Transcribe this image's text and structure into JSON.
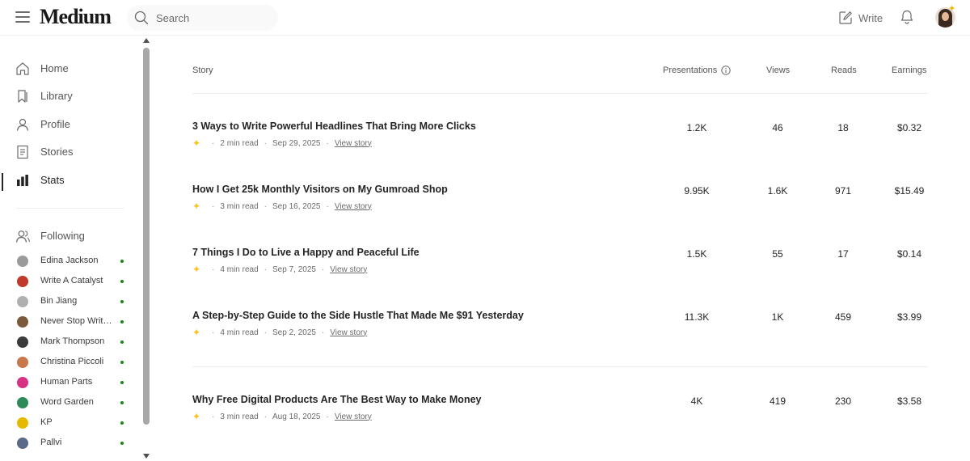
{
  "header": {
    "logo": "Medium",
    "search_placeholder": "Search",
    "write_label": "Write"
  },
  "sidebar": {
    "nav": [
      {
        "label": "Home",
        "icon": "home-icon"
      },
      {
        "label": "Library",
        "icon": "bookmark-icon"
      },
      {
        "label": "Profile",
        "icon": "person-icon"
      },
      {
        "label": "Stories",
        "icon": "document-icon"
      },
      {
        "label": "Stats",
        "icon": "bar-chart-icon",
        "active": true
      }
    ],
    "following_label": "Following",
    "following": [
      {
        "name": "Edina Jackson",
        "color": "#9a9a9a"
      },
      {
        "name": "Write A Catalyst",
        "color": "#c0392b"
      },
      {
        "name": "Bin Jiang",
        "color": "#b0b0b0"
      },
      {
        "name": "Never Stop Writing",
        "color": "#7a5a3a"
      },
      {
        "name": "Mark Thompson",
        "color": "#3b3b3b"
      },
      {
        "name": "Christina Piccoli",
        "color": "#c8784a"
      },
      {
        "name": "Human Parts",
        "color": "#d63384"
      },
      {
        "name": "Word Garden",
        "color": "#2e8b57"
      },
      {
        "name": "KP",
        "color": "#e6b800"
      },
      {
        "name": "Pallvi",
        "color": "#5a6a8a"
      }
    ]
  },
  "table": {
    "columns": {
      "story": "Story",
      "presentations": "Presentations",
      "views": "Views",
      "reads": "Reads",
      "earnings": "Earnings"
    },
    "rows": [
      {
        "title": "3 Ways to Write Powerful Headlines That Bring More Clicks",
        "read_time": "2 min read",
        "date": "Sep 29, 2025",
        "view_label": "View story",
        "presentations": "1.2K",
        "views": "46",
        "reads": "18",
        "earnings": "$0.32"
      },
      {
        "title": "How I Get 25k Monthly Visitors on My Gumroad Shop",
        "read_time": "3 min read",
        "date": "Sep 16, 2025",
        "view_label": "View story",
        "presentations": "9.95K",
        "views": "1.6K",
        "reads": "971",
        "earnings": "$15.49"
      },
      {
        "title": "7 Things I Do to Live a Happy and Peaceful Life",
        "read_time": "4 min read",
        "date": "Sep 7, 2025",
        "view_label": "View story",
        "presentations": "1.5K",
        "views": "55",
        "reads": "17",
        "earnings": "$0.14"
      },
      {
        "title": "A Step-by-Step Guide to the Side Hustle That Made Me $91 Yesterday",
        "read_time": "4 min read",
        "date": "Sep 2, 2025",
        "view_label": "View story",
        "presentations": "11.3K",
        "views": "1K",
        "reads": "459",
        "earnings": "$3.99"
      },
      {
        "title": "Why Free Digital Products Are The Best Way to Make Money",
        "read_time": "3 min read",
        "date": "Aug 18, 2025",
        "view_label": "View story",
        "presentations": "4K",
        "views": "419",
        "reads": "230",
        "earnings": "$3.58"
      }
    ]
  },
  "colors": {
    "accent_green": "#1a8917",
    "star_yellow": "#ffc017"
  }
}
